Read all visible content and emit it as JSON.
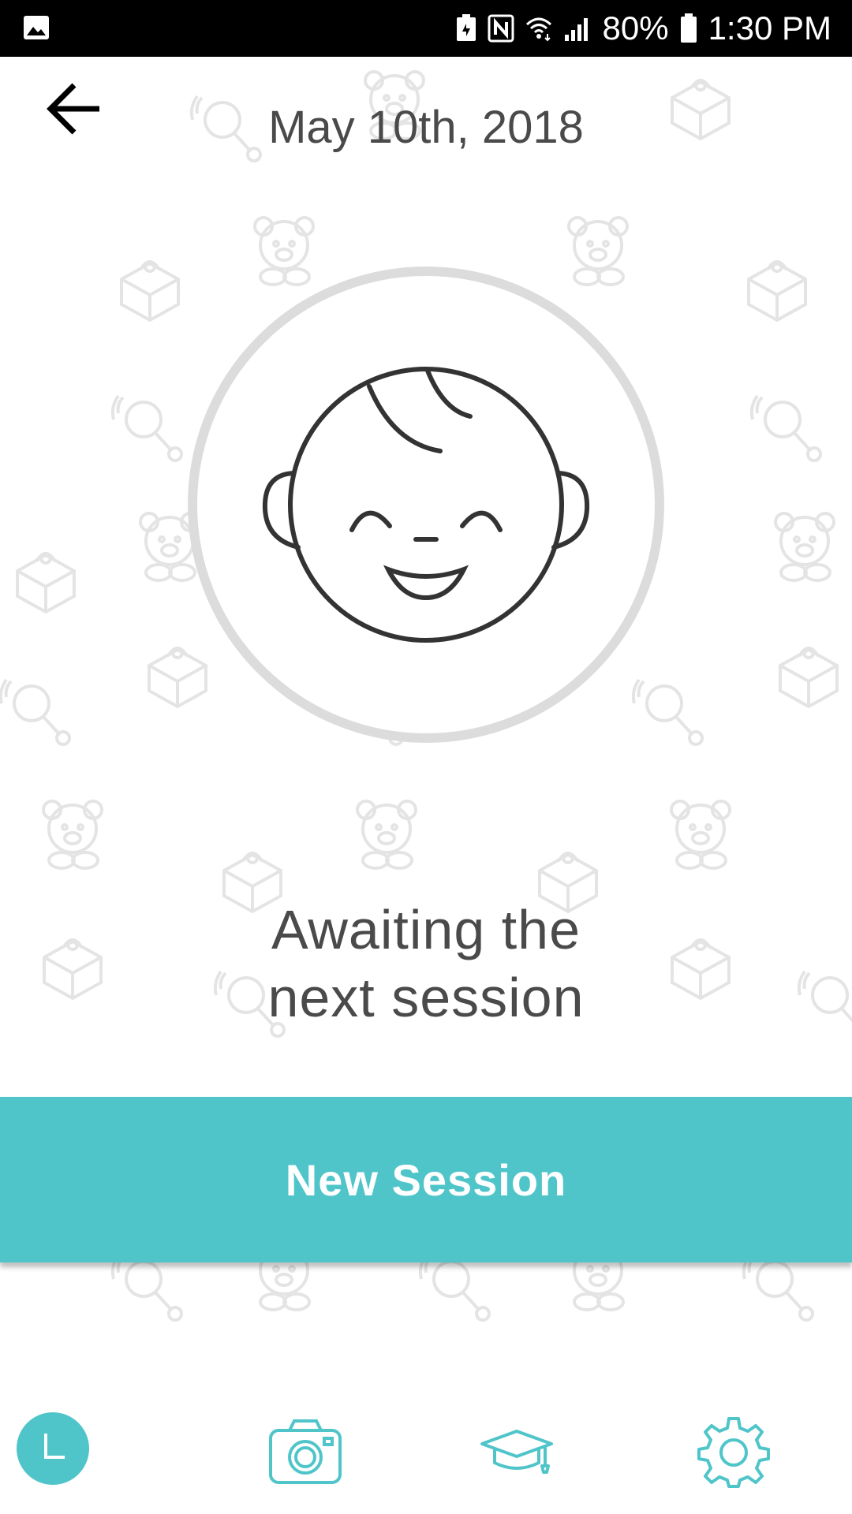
{
  "status_bar": {
    "battery_percent": "80%",
    "time": "1:30 PM",
    "icons": [
      "gallery-icon",
      "battery-saver-icon",
      "nfc-icon",
      "wifi-icon",
      "signal-icon",
      "battery-icon"
    ]
  },
  "header": {
    "back_icon": "arrow-left-icon",
    "date": "May 10th, 2018"
  },
  "avatar": {
    "icon": "baby-face-icon"
  },
  "status_message": {
    "line1": "Awaiting the",
    "line2": "next session"
  },
  "actions": {
    "new_session_label": "New Session"
  },
  "bottom_nav": {
    "items": [
      {
        "icon": "clock-icon",
        "active": true
      },
      {
        "icon": "camera-icon",
        "active": false
      },
      {
        "icon": "graduation-cap-icon",
        "active": false
      },
      {
        "icon": "gear-icon",
        "active": false
      }
    ]
  },
  "colors": {
    "accent": "#4fc5ca",
    "text": "#4a4a4a",
    "ring": "#dcdcdc",
    "status_bar": "#000000",
    "pattern": "#e6e6e6"
  }
}
